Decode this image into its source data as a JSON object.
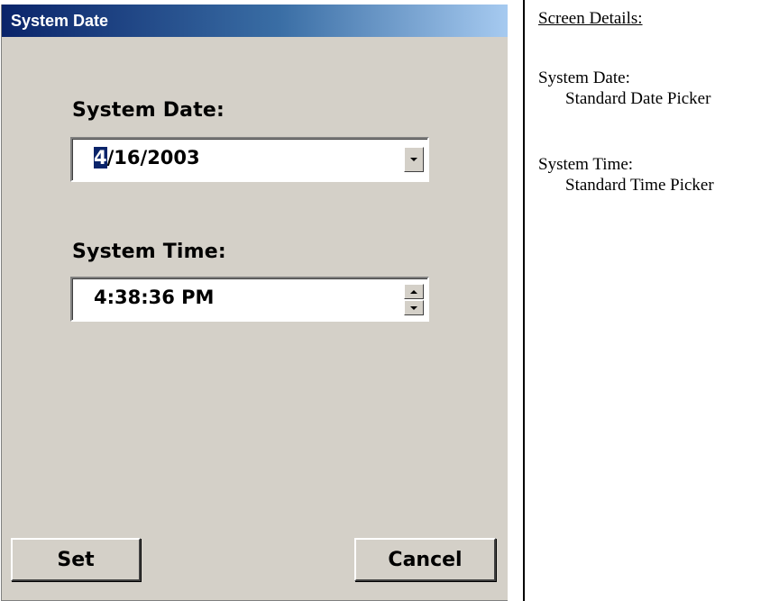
{
  "window": {
    "title": "System Date"
  },
  "date": {
    "label": "System Date:",
    "selected_part": "4",
    "rest": "/16/2003"
  },
  "time": {
    "label": "System Time:",
    "value": "4:38:36 PM"
  },
  "buttons": {
    "set": "Set",
    "cancel": "Cancel"
  },
  "details": {
    "heading": "Screen Details:",
    "items": [
      {
        "name": "System Date:",
        "value": "Standard Date Picker"
      },
      {
        "name": "System Time:",
        "value": "Standard Time Picker"
      }
    ]
  },
  "colors": {
    "titlebar_start": "#0a246a",
    "titlebar_end": "#a6caf0",
    "window_bg": "#d4d0c8"
  },
  "icons": {
    "date_dropdown": "chevron-down-icon",
    "time_up": "spin-up-icon",
    "time_down": "spin-down-icon"
  }
}
